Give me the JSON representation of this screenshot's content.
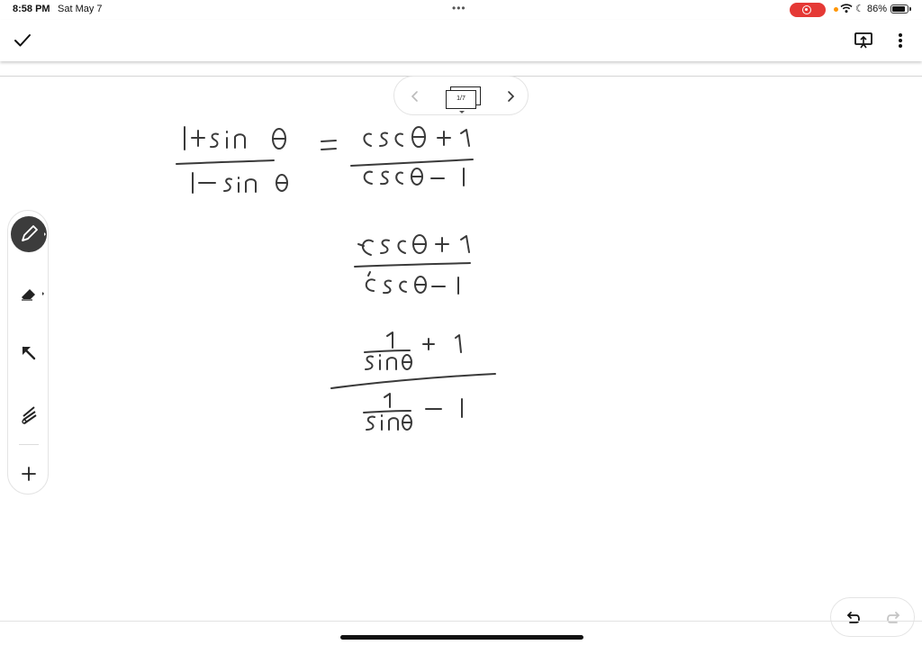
{
  "status": {
    "time": "8:58 PM",
    "date": "Sat May 7",
    "dots": "•••",
    "battery_text": "86%",
    "battery_level": 0.86,
    "recording_color": "#e53935",
    "icons": [
      "recording-icon",
      "wifi-icon",
      "moon-icon",
      "battery-icon"
    ]
  },
  "toolbar": {
    "icons": [
      "checkmark-icon",
      "present-icon",
      "more-vertical-icon"
    ]
  },
  "pager": {
    "page_label": "1/7",
    "icons": [
      "chevron-left-icon",
      "page-thumbnail-icon",
      "chevron-right-icon"
    ]
  },
  "tools": {
    "items": [
      "pen-tool",
      "eraser-tool",
      "select-arrow-tool",
      "lasso-tool",
      "add-tool"
    ],
    "active": "pen-tool",
    "active_color": "#3c3c3c"
  },
  "canvas": {
    "handwriting": [
      {
        "numerator": "1+sinθ",
        "denominator": "1−sinθ"
      },
      {
        "symbol": "="
      },
      {
        "numerator": "cscθ+1",
        "denominator": "cscθ−1"
      },
      {
        "numerator": "cscθ+1",
        "denominator": "cscθ−1"
      },
      {
        "numerator": "1/sinθ + 1",
        "denominator": "1/sinθ − 1"
      }
    ]
  },
  "history": {
    "icons": [
      "undo-icon",
      "redo-icon"
    ]
  }
}
